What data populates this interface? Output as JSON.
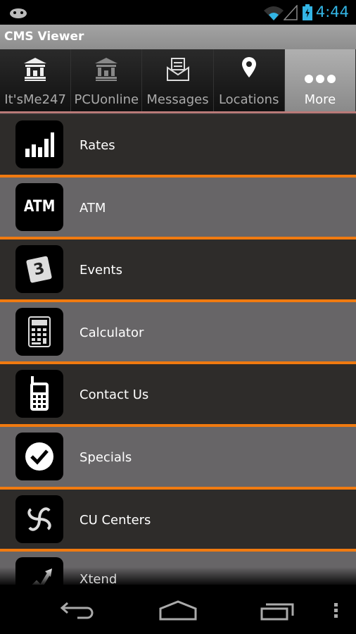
{
  "status": {
    "time": "4:44",
    "icons": [
      "android-icon",
      "wifi-icon",
      "signal-icon",
      "battery-charging-icon"
    ]
  },
  "app": {
    "title": "CMS Viewer"
  },
  "tabs": [
    {
      "label": "It'sMe247",
      "icon": "bank-icon"
    },
    {
      "label": "PCUonline",
      "icon": "bank-icon"
    },
    {
      "label": "Messages",
      "icon": "envelope-icon"
    },
    {
      "label": "Locations",
      "icon": "map-pin-icon"
    },
    {
      "label": "More",
      "icon": "more-dots-icon",
      "active": true
    }
  ],
  "items": [
    {
      "label": "Rates",
      "icon": "bar-chart-icon"
    },
    {
      "label": "ATM",
      "icon": "atm-icon"
    },
    {
      "label": "Events",
      "icon": "calendar-icon"
    },
    {
      "label": "Calculator",
      "icon": "calculator-icon"
    },
    {
      "label": "Contact Us",
      "icon": "phone-icon"
    },
    {
      "label": "Specials",
      "icon": "checkmark-icon"
    },
    {
      "label": "CU Centers",
      "icon": "swirl-icon"
    },
    {
      "label": "Xtend",
      "icon": "arrow-up-icon"
    }
  ],
  "atm_icon_text": "ATM",
  "events_icon_text": "3",
  "colors": {
    "accent": "#f07a10",
    "time": "#33b5e5"
  }
}
